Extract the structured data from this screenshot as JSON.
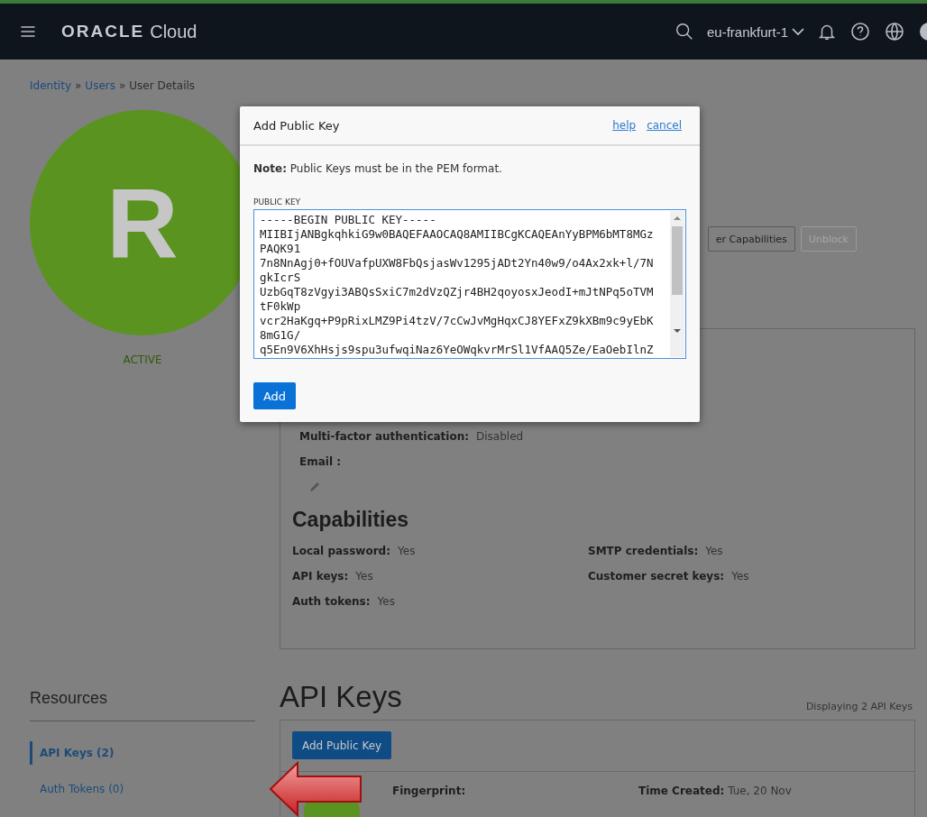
{
  "header": {
    "brand": "ORACLE",
    "product": "Cloud",
    "region": "eu-frankfurt-1"
  },
  "breadcrumb": {
    "items": [
      "Identity",
      "Users",
      "User Details"
    ],
    "separator": "»"
  },
  "user": {
    "avatar_letter": "R",
    "status": "ACTIVE"
  },
  "actions": [
    {
      "label": "er Capabilities",
      "disabled": false
    },
    {
      "label": "Unblock",
      "disabled": true
    }
  ],
  "details": [
    {
      "label": "Multi-factor authentication:",
      "value": "Disabled"
    },
    {
      "label": "Email :",
      "editable": true
    }
  ],
  "capabilities": {
    "title": "Capabilities",
    "items": [
      {
        "label": "Local password:",
        "value": "Yes"
      },
      {
        "label": "SMTP credentials:",
        "value": "Yes"
      },
      {
        "label": "API keys:",
        "value": "Yes"
      },
      {
        "label": "Customer secret keys:",
        "value": "Yes"
      },
      {
        "label": "Auth tokens:",
        "value": "Yes"
      }
    ]
  },
  "resources": {
    "title": "Resources",
    "items": [
      {
        "label": "API Keys (2)",
        "selected": true
      },
      {
        "label": "Auth Tokens (0)",
        "selected": false
      }
    ]
  },
  "api_keys": {
    "title": "API Keys",
    "count": "Displaying 2 API Keys",
    "add_button": "Add Public Key",
    "rows": [
      {
        "fingerprint_label": "Fingerprint:",
        "time_label": "Time Created:",
        "time_value": "Tue, 20 Nov"
      }
    ]
  },
  "dialog": {
    "title": "Add Public Key",
    "links": [
      "help",
      "cancel"
    ],
    "note": "**Note:** Public Keys must be in the PEM format.",
    "field_label": "PUBLIC KEY",
    "field_value": "-----BEGIN PUBLIC KEY-----\nMIIBIjANBgkqhkiG9w0BAQEFAAOCAQ8AMIIBCgKCAQEAnYyBPM6bMT8MGz\nPAQK91\n7n8NnAgj0+fOUVafpUXW8FbQsjasWv1295jADt2Yn40w9/o4Ax2xk+l/7N\ngkIcrS\nUzbGqT8zVgyi3ABQsSxiC7m2dVzQZjr4BH2qoyosxJeodI+mJtNPq5oTVM\ntF0kWp\nvcr2HaKgq+P9pRixLMZ9Pi4tzV/7cCwJvMgHqxCJ8YEFxZ9kXBm9c9yEbK\n8mG1G/\nq5En9V6XhHsjs9spu3ufwqiNaz6YeOWqkvrMrSl1VfAAQ5Ze/EaOebIlnZ",
    "submit": "Add"
  }
}
